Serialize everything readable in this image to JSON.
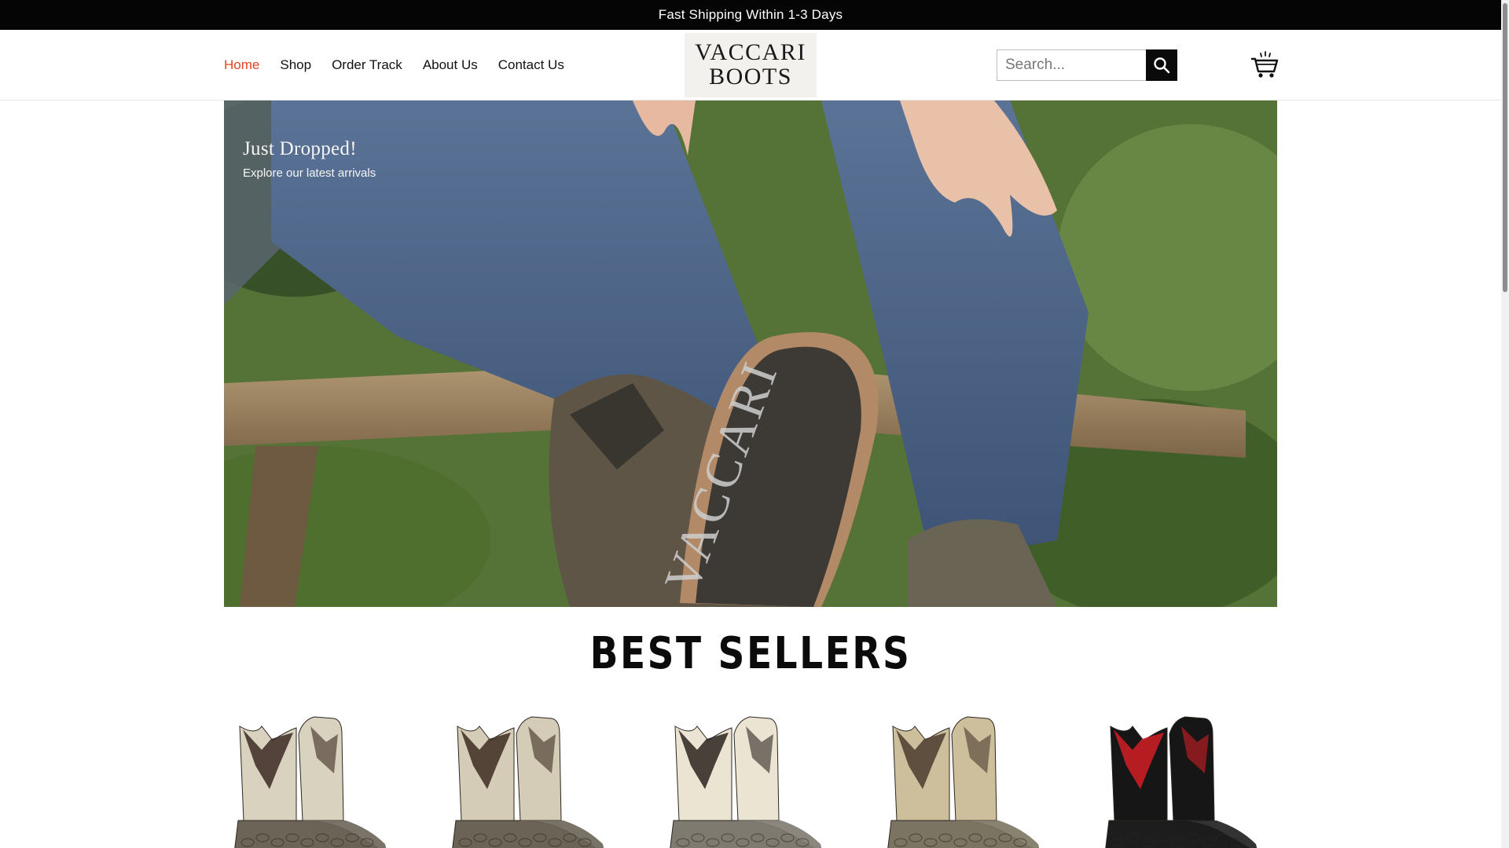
{
  "announcement": "Fast Shipping Within 1-3 Days",
  "nav": {
    "items": [
      {
        "label": "Home",
        "active": true
      },
      {
        "label": "Shop"
      },
      {
        "label": "Order Track"
      },
      {
        "label": "About Us"
      },
      {
        "label": "Contact Us"
      }
    ]
  },
  "logo": {
    "line1": "VACCARI",
    "line2": "BOOTS"
  },
  "search": {
    "placeholder": "Search..."
  },
  "icons": {
    "search": "search-icon",
    "cart": "cart-icon"
  },
  "hero": {
    "title": "Just Dropped!",
    "subtitle": "Explore our latest arrivals",
    "sole_text": "VACCARI"
  },
  "best_sellers": {
    "title": "BEST SELLERS",
    "products": [
      {
        "name": "boot-1",
        "shaft_color": "#d9d2bf",
        "accent": "#3b2a22",
        "foot_color": "#6b6457"
      },
      {
        "name": "boot-2",
        "shaft_color": "#d4ccb6",
        "accent": "#3d2b22",
        "foot_color": "#6a6356"
      },
      {
        "name": "boot-3",
        "shaft_color": "#ece4d2",
        "accent": "#2a2420",
        "foot_color": "#7e7a70"
      },
      {
        "name": "boot-4",
        "shaft_color": "#cdbf9c",
        "accent": "#4a3b2e",
        "foot_color": "#7b7462"
      },
      {
        "name": "boot-5",
        "shaft_color": "#161616",
        "accent": "#d21f26",
        "foot_color": "#1d1d1d"
      }
    ]
  },
  "colors": {
    "accent": "#e5441f",
    "bar": "#050505"
  }
}
